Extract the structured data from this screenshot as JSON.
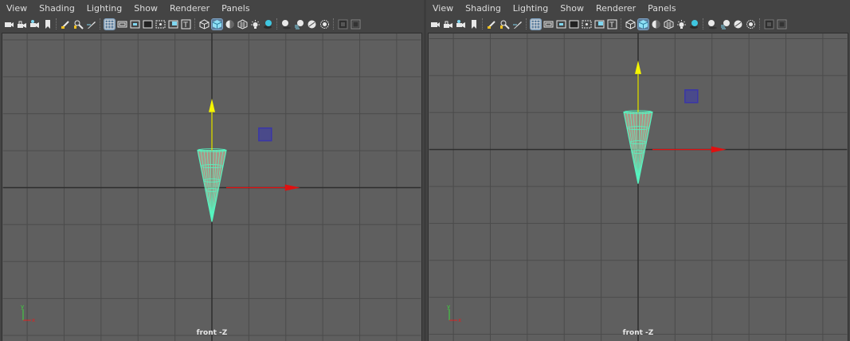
{
  "menus": [
    "View",
    "Shading",
    "Lighting",
    "Show",
    "Renderer",
    "Panels"
  ],
  "toolbar_icons": [
    "camera-icon",
    "lock-camera-icon",
    "camera-attributes-icon",
    "bookmark-icon",
    "sep",
    "image-plane-icon",
    "2d-pan-zoom-icon",
    "grease-pencil-icon",
    "sep",
    "grid-icon",
    "film-gate-icon",
    "resolution-gate-icon",
    "gate-mask-icon",
    "field-chart-icon",
    "safe-action-icon",
    "safe-title-icon",
    "sep",
    "wireframe-icon",
    "smooth-shade-icon",
    "wireframe-on-shaded-icon",
    "textured-icon",
    "use-all-lights-icon",
    "shadows-icon",
    "sep",
    "screen-space-ao-icon",
    "motion-blur-icon",
    "anti-aliasing-icon",
    "depth-of-field-icon",
    "sep",
    "isolate-select-icon",
    "xray-icon"
  ],
  "viewports": [
    {
      "camera_label": "front -Z",
      "axis_y": "y",
      "axis_x": "x"
    },
    {
      "camera_label": "front -Z",
      "axis_y": "y",
      "axis_x": "x"
    }
  ],
  "colors": {
    "cone": "#55f5c0",
    "y_arrow": "#f5f500",
    "x_arrow": "#e01010",
    "cube": "#3a36a8",
    "grid": "#4b4b4b",
    "grid_axis": "#2e2e2e",
    "active_icon": "#5d7f9e"
  }
}
